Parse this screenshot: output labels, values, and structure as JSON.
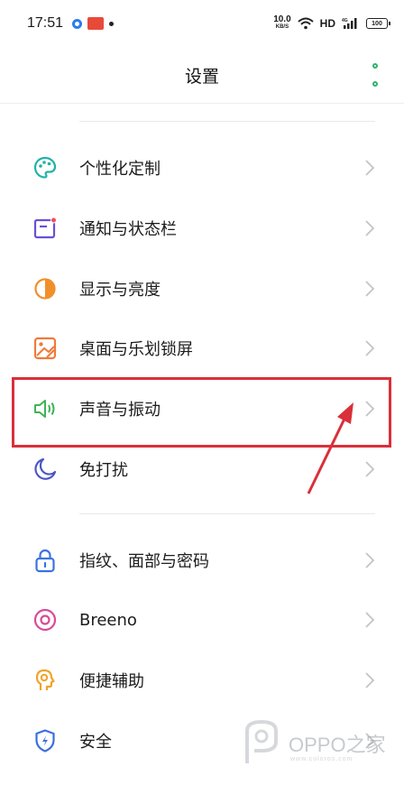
{
  "status_bar": {
    "time": "17:51",
    "net_speed_value": "10.0",
    "net_speed_unit": "KB/S",
    "network_label": "HD",
    "signal_label": "4G",
    "battery": "100"
  },
  "header": {
    "title": "设置"
  },
  "settings": {
    "items": [
      {
        "label": "个性化定制",
        "icon": "palette-icon"
      },
      {
        "label": "通知与状态栏",
        "icon": "notification-icon"
      },
      {
        "label": "显示与亮度",
        "icon": "brightness-icon"
      },
      {
        "label": "桌面与乐划锁屏",
        "icon": "wallpaper-icon"
      },
      {
        "label": "声音与振动",
        "icon": "speaker-icon"
      },
      {
        "label": "免打扰",
        "icon": "moon-icon"
      },
      {
        "label": "指纹、面部与密码",
        "icon": "lock-icon"
      },
      {
        "label": "Breeno",
        "icon": "breeno-icon"
      },
      {
        "label": "便捷辅助",
        "icon": "assist-icon"
      },
      {
        "label": "安全",
        "icon": "shield-icon"
      }
    ]
  },
  "watermark": {
    "text": "OPPO之家",
    "sub": "www.coloros.com"
  },
  "colors": {
    "accent_green": "#2fb36d",
    "highlight_red": "#d9303a"
  }
}
